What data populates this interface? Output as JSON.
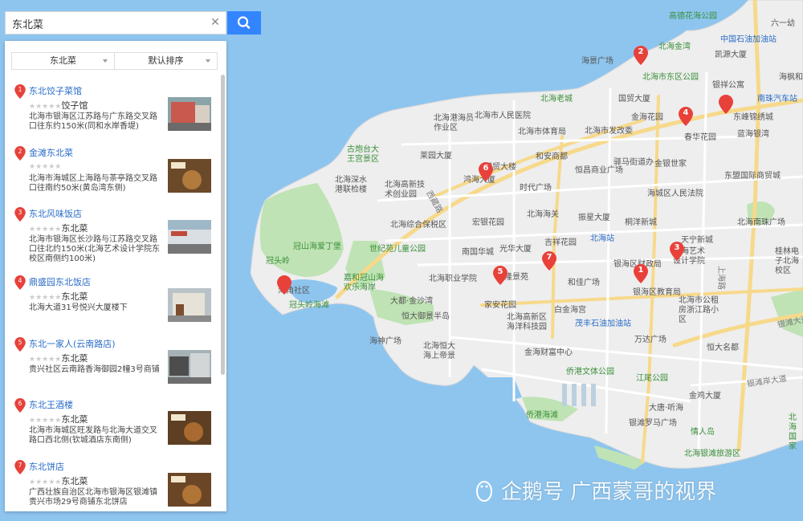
{
  "search": {
    "query": "东北菜"
  },
  "filters": {
    "category": "东北菜",
    "sort": "默认排序"
  },
  "results": [
    {
      "num": "1",
      "name": "东北饺子菜馆",
      "stars": "★★★★★",
      "tag": "饺子馆",
      "addr": "北海市银海区江苏路与广东路交叉路口往东约150米(同和水岸香堤)"
    },
    {
      "num": "2",
      "name": "金滩东北菜",
      "stars": "★★★★★",
      "tag": "",
      "addr": "北海市海城区上海路与茶亭路交叉路口往南约50米(黄岛湾东侧)"
    },
    {
      "num": "3",
      "name": "东北风味饭店",
      "stars": "★★★★★",
      "tag": "东北菜",
      "addr": "北海市银海区长沙路与江苏路交叉路口往北约150米(北海艺术设计学院东校区南侧约100米)"
    },
    {
      "num": "4",
      "name": "鼎盛园东北饭店",
      "stars": "★★★★★",
      "tag": "东北菜",
      "addr": "北海大道31号悦兴大厦楼下"
    },
    {
      "num": "5",
      "name": "东北一家人(云南路店)",
      "stars": "★★★★★",
      "tag": "东北菜",
      "addr": "贵兴社区云南路香海御园2幢3号商铺"
    },
    {
      "num": "6",
      "name": "东北王酒楼",
      "stars": "★★★★★",
      "tag": "东北菜",
      "addr": "北海市海城区旺发路与北海大道交叉路口西北侧(钦城酒店东南侧)"
    },
    {
      "num": "7",
      "name": "东北饼店",
      "stars": "★★★★★",
      "tag": "东北菜",
      "addr": "广西壮族自治区北海市银海区银滩镇贵兴市场29号商铺东北饼店"
    }
  ],
  "map_labels": {
    "l01": "高德花海公园",
    "l02": "中国石油加油站",
    "l03": "六一幼",
    "l04": "北海金湾",
    "l05": "海景广场",
    "l06": "凯源大厦",
    "l07": "北海市东区公园",
    "l08": "银祥公寓",
    "l09": "海枫和",
    "l10": "北海老城",
    "l11": "国贸大厦",
    "l12": "南珠汽车站",
    "l13": "北海港海员作业区",
    "l14": "北海市人民医院",
    "l15": "金海花园",
    "l16": "东峰锦绣城",
    "l17": "古炮台大王宫景区",
    "l18": "北海市体育局",
    "l19": "北海市发改委",
    "l20": "春华花园",
    "l21": "蓝海银湾",
    "l22": "莱园大厦",
    "l23": "和安商都",
    "l24": "驿马街道办",
    "l25": "北海深水港联检楼",
    "l26": "鸿海大厦",
    "l27": "国贸大楼",
    "l28": "恒昌商业广场",
    "l29": "金银世家",
    "l30": "东盟国际商贸城",
    "l31": "北海高新技术创业园",
    "l32": "时代广场",
    "l33": "海城区人民法院",
    "l34": "西藏路",
    "l35": "宏银花园",
    "l36": "北海海关",
    "l37": "振星大厦",
    "l38": "桐洋新城",
    "l39": "北海南珠广场",
    "l40": "北海综合保税区",
    "l41": "北海站",
    "l42": "天宁新城",
    "l43": "冠头岭",
    "l44": "冠山海爱丁堡",
    "l45": "世纪苑儿童公园",
    "l46": "南国华城",
    "l47": "光华大厦",
    "l48": "吉祥花园",
    "l49": "北海艺术设计学院",
    "l50": "桂林电子北海校区",
    "l51": "嘉和冠山海欢乐海岸",
    "l52": "银海区财政局",
    "l53": "北海职业学院",
    "l54": "隆景苑",
    "l55": "和佳广场",
    "l56": "银海区教育局",
    "l57": "海角社区",
    "l58": "冠头岭海滩",
    "l59": "大都·金沙湾",
    "l60": "家安花园",
    "l61": "北海高新区海洋科技园",
    "l62": "白金海宫",
    "l63": "北海市公租房浙江路小区",
    "l64": "恒大御景半岛",
    "l65": "茂丰石油加油站",
    "l66": "银滩大道",
    "l67": "海神广场",
    "l68": "北海恒大海上帝景",
    "l69": "万达广场",
    "l70": "恒大名都",
    "l71": "金海财富中心",
    "l72": "侨港文体公园",
    "l73": "江尾公园",
    "l74": "银滩岸大道",
    "l75": "金鸡大厦",
    "l76": "大唐·听海",
    "l77": "北海国家",
    "l78": "侨港海滩",
    "l79": "银滩罗马广场",
    "l80": "情人岛",
    "l81": "北海银滩旅游区",
    "l82": "上海路"
  },
  "watermark": "企鹅号 广西蒙哥的视界"
}
